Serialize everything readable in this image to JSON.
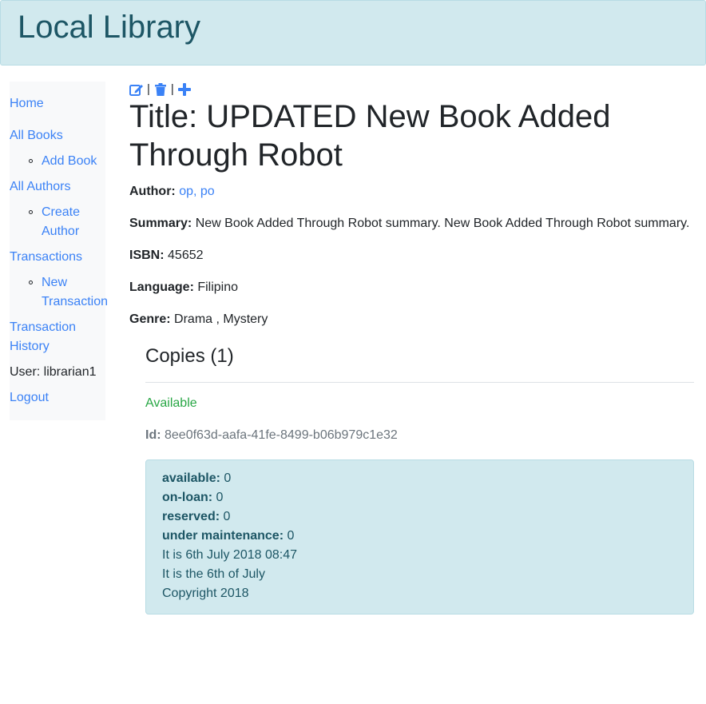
{
  "header": {
    "title": "Local Library"
  },
  "sidebar": {
    "home": "Home",
    "all_books": "All Books",
    "add_book": "Add Book",
    "all_authors": "All Authors",
    "create_author_line1": "Create",
    "create_author_line2": "Author",
    "transactions": "Transactions",
    "new_transaction_line1": "New",
    "new_transaction_line2": "Transaction",
    "transaction_history_line1": "Transaction",
    "transaction_history_line2": "History",
    "user": "User: librarian1",
    "logout": "Logout"
  },
  "actions": {
    "edit_icon": "edit-icon",
    "delete_icon": "trash-icon",
    "add_icon": "plus-icon",
    "separator": "|"
  },
  "book": {
    "title_line1": "Title: UPDATED New Book Added",
    "title_line2": "Through Robot",
    "author_label": "Author:",
    "author_value": "op, po",
    "summary_label": "Summary:",
    "summary_value": "New Book Added Through Robot summary. New Book Added Through Robot summary.",
    "isbn_label": "ISBN:",
    "isbn_value": "45652",
    "language_label": "Language:",
    "language_value": "Filipino",
    "genre_label": "Genre:",
    "genre_value": "Drama , Mystery"
  },
  "copies": {
    "heading": "Copies (1)",
    "status": "Available",
    "id_label": "Id:",
    "id_value": "8ee0f63d-aafa-41fe-8499-b06b979c1e32"
  },
  "info": {
    "available_label": "available:",
    "available_value": "0",
    "onloan_label": "on-loan:",
    "onloan_value": "0",
    "reserved_label": "reserved:",
    "reserved_value": "0",
    "maintenance_label": "under maintenance:",
    "maintenance_value": "0",
    "date_line": "It is 6th July 2018 08:47",
    "date_line2": "It is the 6th of July",
    "copyright": "Copyright 2018"
  },
  "colors": {
    "link": "#3b82f6",
    "header_bg": "#d1e9ee",
    "available": "#28a745",
    "muted": "#6c757d"
  }
}
